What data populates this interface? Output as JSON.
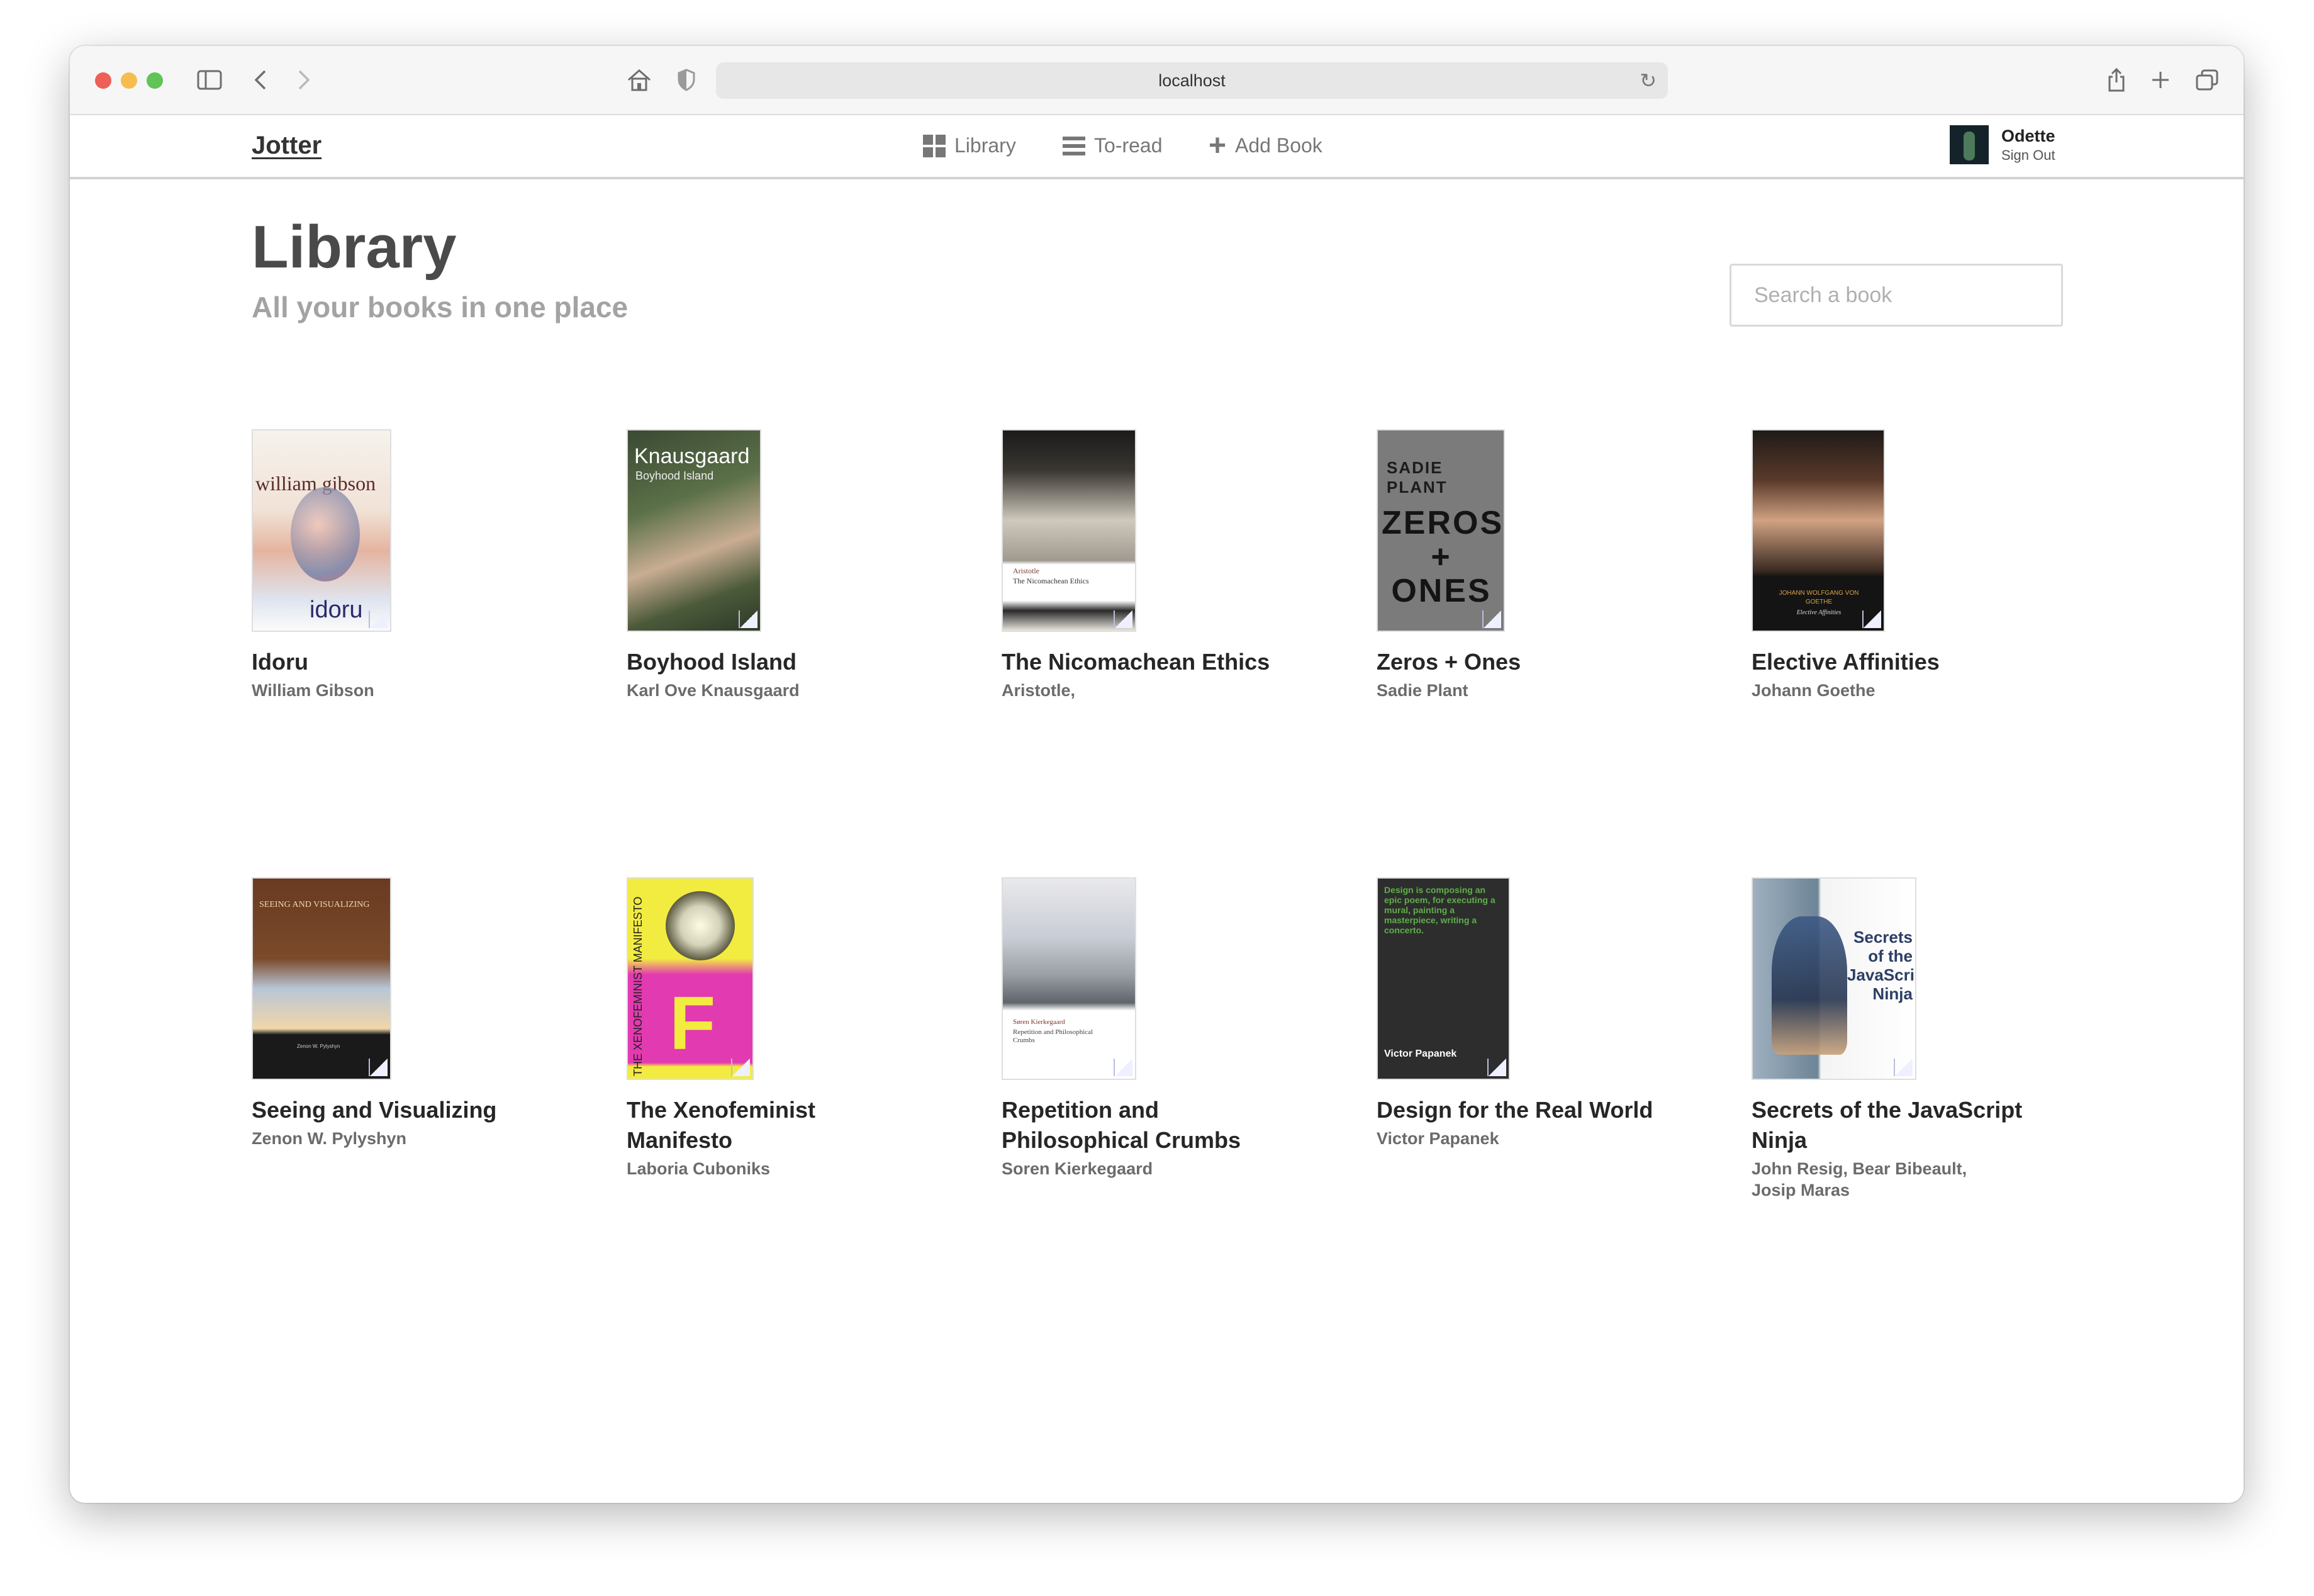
{
  "browser": {
    "url": "localhost"
  },
  "app": {
    "logo": "Jotter",
    "nav": [
      {
        "label": "Library",
        "icon": "grid-icon"
      },
      {
        "label": "To-read",
        "icon": "list-icon"
      },
      {
        "label": "Add Book",
        "icon": "plus-icon"
      }
    ],
    "user": {
      "name": "Odette",
      "sign_out": "Sign Out"
    }
  },
  "page": {
    "title": "Library",
    "subtitle": "All your books in one place",
    "search_placeholder": "Search a book"
  },
  "books": [
    {
      "title": "Idoru",
      "author": "William Gibson",
      "cover_text": "william gibson",
      "cover_sub": "idoru"
    },
    {
      "title": "Boyhood Island",
      "author": "Karl Ove Knausgaard",
      "cover_text": "Knausgaard",
      "cover_sub": "Boyhood Island"
    },
    {
      "title": "The Nicomachean Ethics",
      "author": "Aristotle,",
      "cover_text": "Aristotle",
      "cover_sub": "The Nicomachean Ethics"
    },
    {
      "title": "Zeros + Ones",
      "author": "Sadie Plant",
      "cover_text": "SADIE PLANT",
      "cover_sub": "ZEROS + ONES"
    },
    {
      "title": "Elective Affinities",
      "author": "Johann Goethe",
      "cover_text": "JOHANN WOLFGANG VON GOETHE",
      "cover_sub": "Elective Affinities"
    },
    {
      "title": "Seeing and Visualizing",
      "author": "Zenon W. Pylyshyn",
      "cover_text": "SEEING AND VISUALIZING",
      "cover_sub": "Zenon W. Pylyshyn"
    },
    {
      "title": "The Xenofeminist Manifesto",
      "author": "Laboria Cuboniks",
      "cover_text": "THE XENOFEMINIST MANIFESTO",
      "cover_sub": "F"
    },
    {
      "title": "Repetition and Philosophical Crumbs",
      "author": "Soren Kierkegaard",
      "cover_text": "Søren Kierkegaard",
      "cover_sub": "Repetition and Philosophical Crumbs"
    },
    {
      "title": "Design for the Real World",
      "author": "Victor Papanek",
      "cover_text": "Design is composing an epic poem, for executing a mural, painting a masterpiece, writing a concerto.",
      "cover_sub": "Victor Papanek"
    },
    {
      "title": "Secrets of the JavaScript Ninja",
      "author": "John Resig, Bear Bibeault, Josip Maras",
      "cover_text": "Secrets of the JavaScript Ninja",
      "cover_sub": ""
    }
  ],
  "colors": {
    "accent_text": "#4a4a4a",
    "muted_text": "#a3a3a3",
    "border": "#d9d9d9"
  }
}
